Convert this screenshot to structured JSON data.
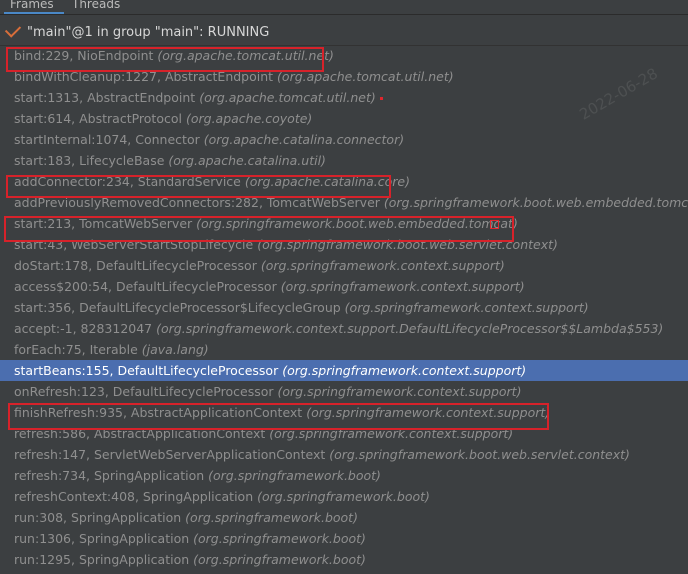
{
  "tabs": {
    "frames": "Frames",
    "threads": "Threads"
  },
  "thread": {
    "label": "\"main\"@1 in group \"main\": RUNNING"
  },
  "watermarks": {
    "date": "2022-06-28"
  },
  "frames": [
    {
      "method": "bind:229, NioEndpoint",
      "pkg": "(org.apache.tomcat.util.net)"
    },
    {
      "method": "bindWithCleanup:1227, AbstractEndpoint",
      "pkg": "(org.apache.tomcat.util.net)"
    },
    {
      "method": "start:1313, AbstractEndpoint",
      "pkg": "(org.apache.tomcat.util.net)"
    },
    {
      "method": "start:614, AbstractProtocol",
      "pkg": "(org.apache.coyote)"
    },
    {
      "method": "startInternal:1074, Connector",
      "pkg": "(org.apache.catalina.connector)"
    },
    {
      "method": "start:183, LifecycleBase",
      "pkg": "(org.apache.catalina.util)"
    },
    {
      "method": "addConnector:234, StandardService",
      "pkg": "(org.apache.catalina.core)"
    },
    {
      "method": "addPreviouslyRemovedConnectors:282, TomcatWebServer",
      "pkg": "(org.springframework.boot.web.embedded.tomcat)"
    },
    {
      "method": "start:213, TomcatWebServer",
      "pkg": "(org.springframework.boot.web.embedded.tomcat)"
    },
    {
      "method": "start:43, WebServerStartStopLifecycle",
      "pkg": "(org.springframework.boot.web.servlet.context)"
    },
    {
      "method": "doStart:178, DefaultLifecycleProcessor",
      "pkg": "(org.springframework.context.support)"
    },
    {
      "method": "access$200:54, DefaultLifecycleProcessor",
      "pkg": "(org.springframework.context.support)"
    },
    {
      "method": "start:356, DefaultLifecycleProcessor$LifecycleGroup",
      "pkg": "(org.springframework.context.support)"
    },
    {
      "method": "accept:-1, 828312047",
      "pkg": "(org.springframework.context.support.DefaultLifecycleProcessor$$Lambda$553)"
    },
    {
      "method": "forEach:75, Iterable",
      "pkg": "(java.lang)"
    },
    {
      "method": "startBeans:155, DefaultLifecycleProcessor",
      "pkg": "(org.springframework.context.support)",
      "selected": true
    },
    {
      "method": "onRefresh:123, DefaultLifecycleProcessor",
      "pkg": "(org.springframework.context.support)"
    },
    {
      "method": "finishRefresh:935, AbstractApplicationContext",
      "pkg": "(org.springframework.context.support)"
    },
    {
      "method": "refresh:586, AbstractApplicationContext",
      "pkg": "(org.springframework.context.support)"
    },
    {
      "method": "refresh:147, ServletWebServerApplicationContext",
      "pkg": "(org.springframework.boot.web.servlet.context)"
    },
    {
      "method": "refresh:734, SpringApplication",
      "pkg": "(org.springframework.boot)"
    },
    {
      "method": "refreshContext:408, SpringApplication",
      "pkg": "(org.springframework.boot)"
    },
    {
      "method": "run:308, SpringApplication",
      "pkg": "(org.springframework.boot)"
    },
    {
      "method": "run:1306, SpringApplication",
      "pkg": "(org.springframework.boot)"
    },
    {
      "method": "run:1295, SpringApplication",
      "pkg": "(org.springframework.boot)"
    }
  ],
  "colors": {
    "background": "#3c3f41",
    "selection": "#4b6eaf",
    "annotation": "#d7222a",
    "running_check": "#d86e3a"
  }
}
